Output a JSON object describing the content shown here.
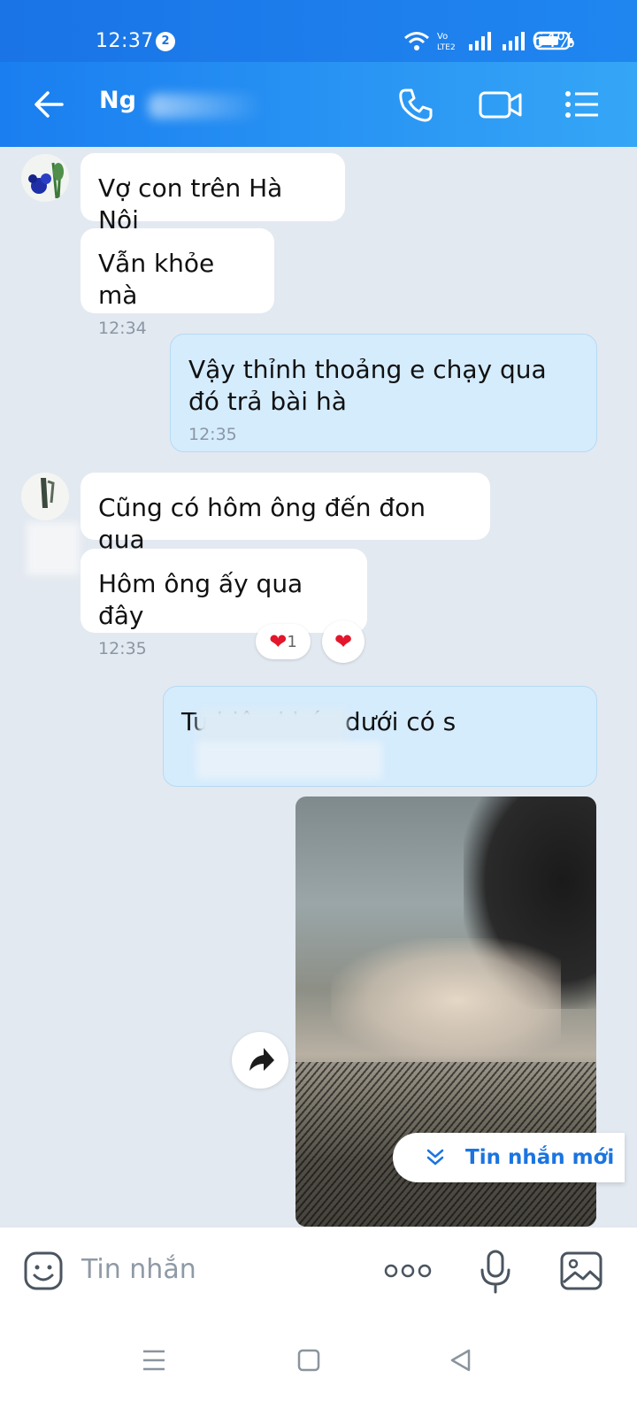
{
  "status_bar": {
    "time": "12:37",
    "notification_count": "2",
    "battery": "64%"
  },
  "header": {
    "contact_name": "Ng"
  },
  "messages": [
    {
      "direction": "in",
      "text": "Vợ con trên Hà Nội",
      "time": ""
    },
    {
      "direction": "in",
      "text": "Vẫn khỏe mà",
      "time": "12:34"
    },
    {
      "direction": "out",
      "text": "Vậy thỉnh thoảng e chạy qua đó trả bài hà",
      "time": "12:35"
    },
    {
      "direction": "in",
      "text": "Cũng có hôm ông đến đon qua",
      "time": ""
    },
    {
      "direction": "in",
      "text": "Hôm ông ấy qua đây",
      "time": "12:35"
    },
    {
      "direction": "out",
      "text": "Tu         biên khúc dưới có s",
      "time": ""
    }
  ],
  "reactions": {
    "heart_count": "1"
  },
  "new_messages_label": "Tin nhắn mới",
  "input": {
    "placeholder": "Tin nhắn"
  },
  "colors": {
    "header_start": "#1a7ef0",
    "header_end": "#35a6f6",
    "background": "#e3e9f1",
    "outgoing_bubble": "#d5ecfd",
    "incoming_bubble": "#ffffff",
    "accent": "#1b74e0",
    "heart": "#e3162b"
  },
  "icons": [
    "back-arrow-icon",
    "phone-icon",
    "video-call-icon",
    "menu-list-icon",
    "share-icon",
    "chevron-down-double-icon",
    "sticker-icon",
    "more-dots-icon",
    "microphone-icon",
    "image-icon",
    "nav-menu-icon",
    "nav-home-icon",
    "nav-back-icon"
  ]
}
